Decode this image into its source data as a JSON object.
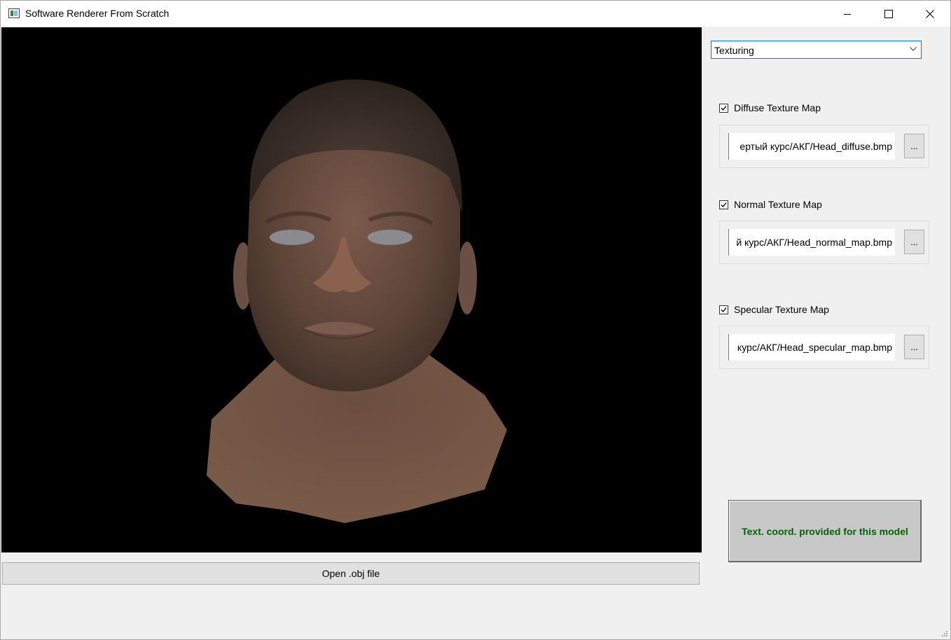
{
  "window": {
    "title": "Software Renderer From Scratch",
    "icon": "app-window-icon",
    "controls": [
      "minimize-icon",
      "maximize-icon",
      "close-icon"
    ]
  },
  "viewport": {
    "background": "#000000",
    "content": "rendered textured 3D head model"
  },
  "open_button": {
    "label": "Open .obj file"
  },
  "mode_select": {
    "value": "Texturing",
    "accent": "#0078d7"
  },
  "texture_maps": [
    {
      "label": "Diffuse Texture Map",
      "checked": true,
      "path": "ертый курс/АКГ/Head_diffuse.bmp",
      "browse_label": "..."
    },
    {
      "label": "Normal Texture Map",
      "checked": true,
      "path": "й курс/АКГ/Head_normal_map.bmp",
      "browse_label": "..."
    },
    {
      "label": "Specular Texture Map",
      "checked": true,
      "path": "курс/АКГ/Head_specular_map.bmp",
      "browse_label": "..."
    }
  ],
  "status": {
    "text": "Text. coord. provided for this model",
    "color": "#006400"
  }
}
